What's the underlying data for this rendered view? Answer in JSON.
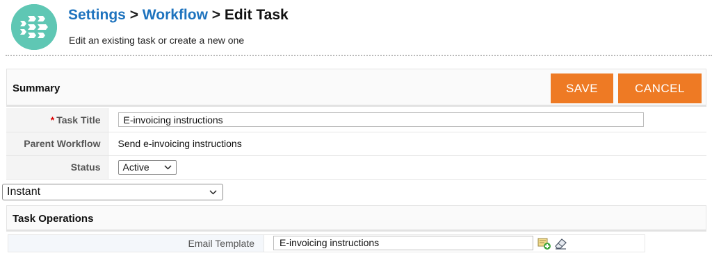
{
  "header": {
    "breadcrumb": [
      {
        "label": "Settings",
        "link": true
      },
      {
        "label": "Workflow",
        "link": true
      },
      {
        "label": "Edit Task",
        "link": false
      }
    ],
    "separator": ">",
    "subtitle": "Edit an existing task or create a new one"
  },
  "summary": {
    "title": "Summary",
    "save_label": "SAVE",
    "cancel_label": "CANCEL"
  },
  "form": {
    "required_mark": "*",
    "task_title_label": "Task Title",
    "task_title_value": "E-invoicing instructions",
    "parent_workflow_label": "Parent Workflow",
    "parent_workflow_value": "Send e-invoicing instructions",
    "status_label": "Status",
    "status_value": "Active"
  },
  "trigger": {
    "selected": "Instant"
  },
  "task_operations": {
    "title": "Task Operations",
    "email_template_label": "Email Template",
    "email_template_value": "E-invoicing instructions",
    "icons": [
      "add-template-icon",
      "eraser-icon"
    ]
  },
  "colors": {
    "link": "#1e73be",
    "accent_orange": "#ee7a24",
    "logo_teal": "#5fc7b4",
    "required": "#dd0000"
  }
}
